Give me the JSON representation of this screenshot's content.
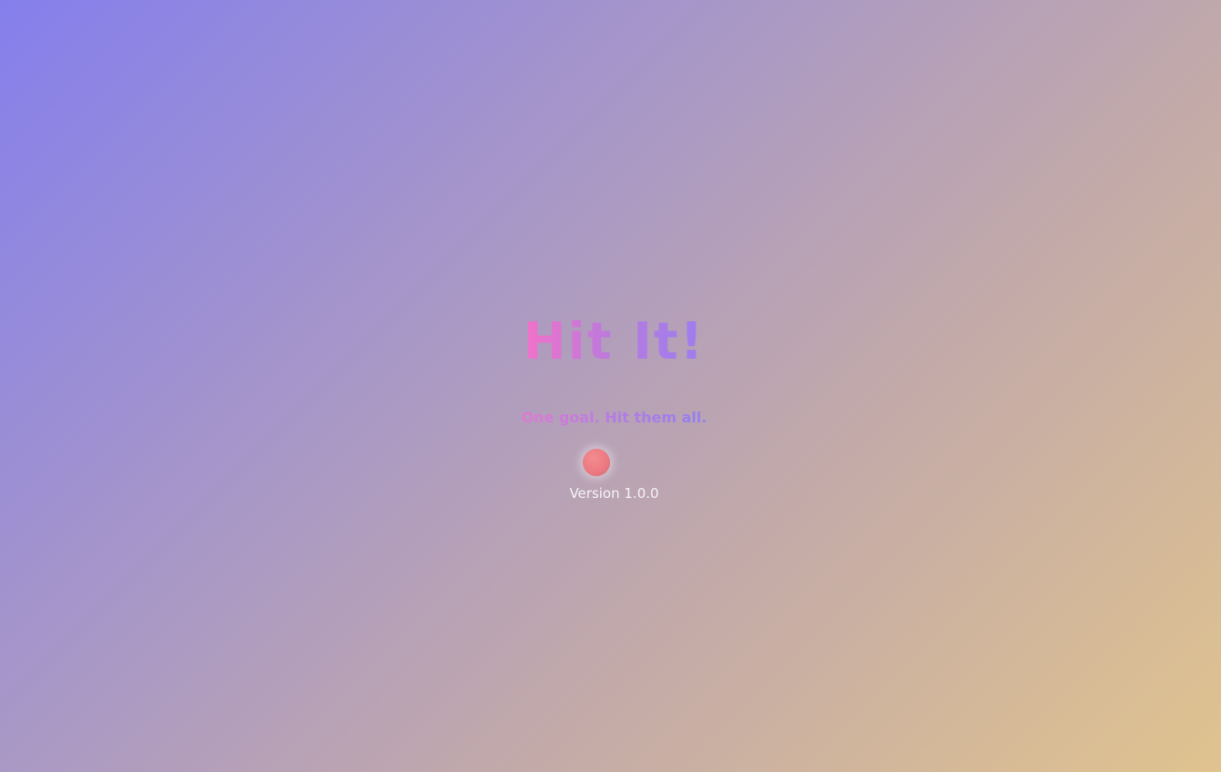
{
  "app": {
    "title": "Hit It!",
    "tagline": "One goal. Hit them all.",
    "version": "Version 1.0.0"
  },
  "loader": {
    "icon": "ball-icon",
    "color": "#ec7a82"
  },
  "theme": {
    "background_start": "#857fec",
    "background_end": "#e0c38f",
    "title_gradient_start": "#f271c9",
    "title_gradient_end": "#9d7df0"
  }
}
